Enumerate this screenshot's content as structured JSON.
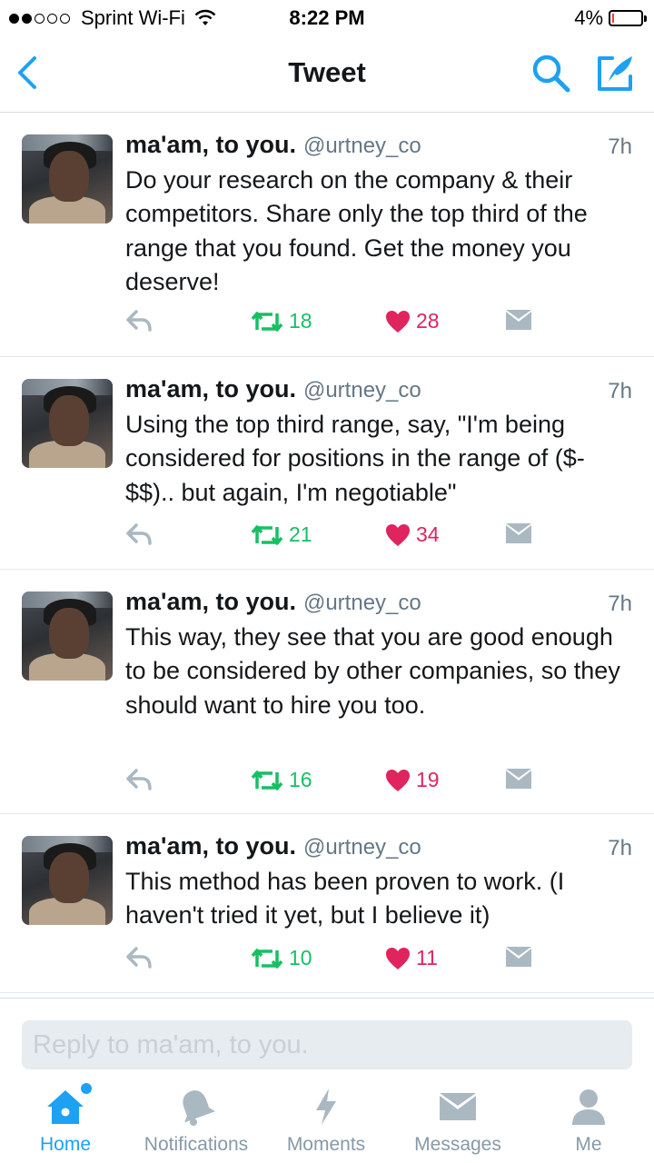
{
  "status_bar": {
    "carrier": "Sprint Wi-Fi",
    "time": "8:22 PM",
    "battery": "4%"
  },
  "nav": {
    "title": "Tweet",
    "accent_color": "#1da1f2"
  },
  "tweets": [
    {
      "name": "ma'am, to you.",
      "handle": "@urtney_co",
      "time": "7h",
      "text": "Do your research on the company & their competitors. Share only the top third of the range that you found. Get the money you deserve!",
      "retweets": "18",
      "likes": "28"
    },
    {
      "name": "ma'am, to you.",
      "handle": "@urtney_co",
      "time": "7h",
      "text": "Using the top third range, say, \"I'm being considered for positions in the range of ($- $$).. but again, I'm negotiable\"",
      "retweets": "21",
      "likes": "34"
    },
    {
      "name": "ma'am, to you.",
      "handle": "@urtney_co",
      "time": "7h",
      "text": "This way, they see that you are good enough to be considered by other companies, so they should want to hire you too.",
      "retweets": "16",
      "likes": "19"
    },
    {
      "name": "ma'am, to you.",
      "handle": "@urtney_co",
      "time": "7h",
      "text": "This method has been proven to work. (I haven't tried it yet, but I believe it)",
      "retweets": "10",
      "likes": "11"
    }
  ],
  "reply": {
    "placeholder": "Reply to ma'am, to you."
  },
  "tabs": [
    {
      "label": "Home",
      "icon": "home-icon",
      "active": true
    },
    {
      "label": "Notifications",
      "icon": "bell-icon",
      "active": false
    },
    {
      "label": "Moments",
      "icon": "lightning-icon",
      "active": false
    },
    {
      "label": "Messages",
      "icon": "envelope-icon",
      "active": false
    },
    {
      "label": "Me",
      "icon": "person-icon",
      "active": false
    }
  ]
}
